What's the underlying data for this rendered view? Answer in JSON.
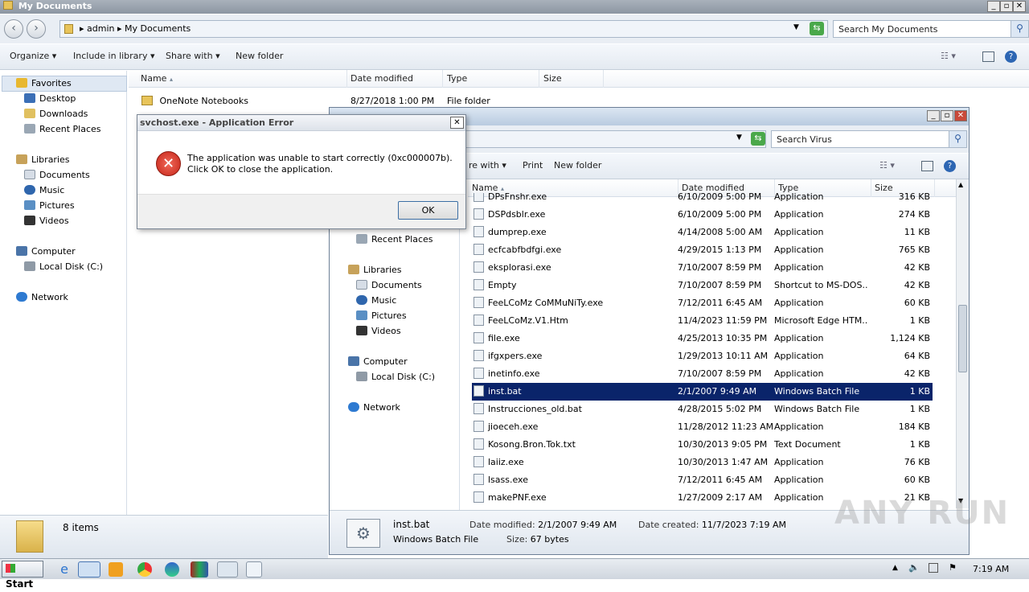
{
  "back_window": {
    "title": "My Documents",
    "breadcrumb": [
      "admin",
      "My Documents"
    ],
    "search_placeholder": "Search My Documents",
    "toolbar": {
      "organize": "Organize",
      "include": "Include in library",
      "share": "Share with",
      "new_folder": "New folder"
    },
    "columns": [
      "Name",
      "Date modified",
      "Type",
      "Size"
    ],
    "rows": [
      {
        "name": "OneNote Notebooks",
        "date": "8/27/2018 1:00 PM",
        "type": "File folder",
        "size": ""
      }
    ],
    "nav": {
      "favorites": "Favorites",
      "desktop": "Desktop",
      "downloads": "Downloads",
      "recent": "Recent Places",
      "libraries": "Libraries",
      "documents": "Documents",
      "music": "Music",
      "pictures": "Pictures",
      "videos": "Videos",
      "computer": "Computer",
      "local_disk": "Local Disk (C:)",
      "network": "Network"
    },
    "status": {
      "count": "8 items"
    }
  },
  "front_window": {
    "search_placeholder": "Search Virus",
    "toolbar": {
      "share": "re with",
      "print": "Print",
      "new_folder": "New folder"
    },
    "columns": [
      "Name",
      "Date modified",
      "Type",
      "Size"
    ],
    "nav": {
      "recent": "Recent Places",
      "libraries": "Libraries",
      "documents": "Documents",
      "music": "Music",
      "pictures": "Pictures",
      "videos": "Videos",
      "computer": "Computer",
      "local_disk": "Local Disk (C:)",
      "network": "Network"
    },
    "rows": [
      {
        "name": "DPsFnshr.exe",
        "date": "6/10/2009 5:00 PM",
        "type": "Application",
        "size": "316 KB"
      },
      {
        "name": "DSPdsblr.exe",
        "date": "6/10/2009 5:00 PM",
        "type": "Application",
        "size": "274 KB"
      },
      {
        "name": "dumprep.exe",
        "date": "4/14/2008 5:00 AM",
        "type": "Application",
        "size": "11 KB"
      },
      {
        "name": "ecfcabfbdfgi.exe",
        "date": "4/29/2015 1:13 PM",
        "type": "Application",
        "size": "765 KB"
      },
      {
        "name": "eksplorasi.exe",
        "date": "7/10/2007 8:59 PM",
        "type": "Application",
        "size": "42 KB"
      },
      {
        "name": "Empty",
        "date": "7/10/2007 8:59 PM",
        "type": "Shortcut to MS-DOS...",
        "size": "42 KB"
      },
      {
        "name": "FeeLCoMz CoMMuNiTy.exe",
        "date": "7/12/2011 6:45 AM",
        "type": "Application",
        "size": "60 KB"
      },
      {
        "name": "FeeLCoMz.V1.Htm",
        "date": "11/4/2023 11:59 PM",
        "type": "Microsoft Edge HTM...",
        "size": "1 KB"
      },
      {
        "name": "file.exe",
        "date": "4/25/2013 10:35 PM",
        "type": "Application",
        "size": "1,124 KB"
      },
      {
        "name": "ifgxpers.exe",
        "date": "1/29/2013 10:11 AM",
        "type": "Application",
        "size": "64 KB"
      },
      {
        "name": "inetinfo.exe",
        "date": "7/10/2007 8:59 PM",
        "type": "Application",
        "size": "42 KB"
      },
      {
        "name": "inst.bat",
        "date": "2/1/2007 9:49 AM",
        "type": "Windows Batch File",
        "size": "1 KB"
      },
      {
        "name": "Instrucciones_old.bat",
        "date": "4/28/2015 5:02 PM",
        "type": "Windows Batch File",
        "size": "1 KB"
      },
      {
        "name": "jioeceh.exe",
        "date": "11/28/2012 11:23 AM",
        "type": "Application",
        "size": "184 KB"
      },
      {
        "name": "Kosong.Bron.Tok.txt",
        "date": "10/30/2013 9:05 PM",
        "type": "Text Document",
        "size": "1 KB"
      },
      {
        "name": "laiiz.exe",
        "date": "10/30/2013 1:47 AM",
        "type": "Application",
        "size": "76 KB"
      },
      {
        "name": "lsass.exe",
        "date": "7/12/2011 6:45 AM",
        "type": "Application",
        "size": "60 KB"
      },
      {
        "name": "makePNF.exe",
        "date": "1/27/2009 2:17 AM",
        "type": "Application",
        "size": "21 KB"
      }
    ],
    "details": {
      "name": "inst.bat",
      "type": "Windows Batch File",
      "modified_label": "Date modified:",
      "modified": "2/1/2007 9:49 AM",
      "created_label": "Date created:",
      "created": "11/7/2023 7:19 AM",
      "size_label": "Size:",
      "size": "67 bytes"
    }
  },
  "dialog": {
    "title": "svchost.exe - Application Error",
    "message": "The application was unable to start correctly (0xc000007b). Click OK to close the application.",
    "ok": "OK"
  },
  "taskbar": {
    "start": "Start",
    "time": "7:19 AM"
  },
  "watermark": "ANY RUN"
}
